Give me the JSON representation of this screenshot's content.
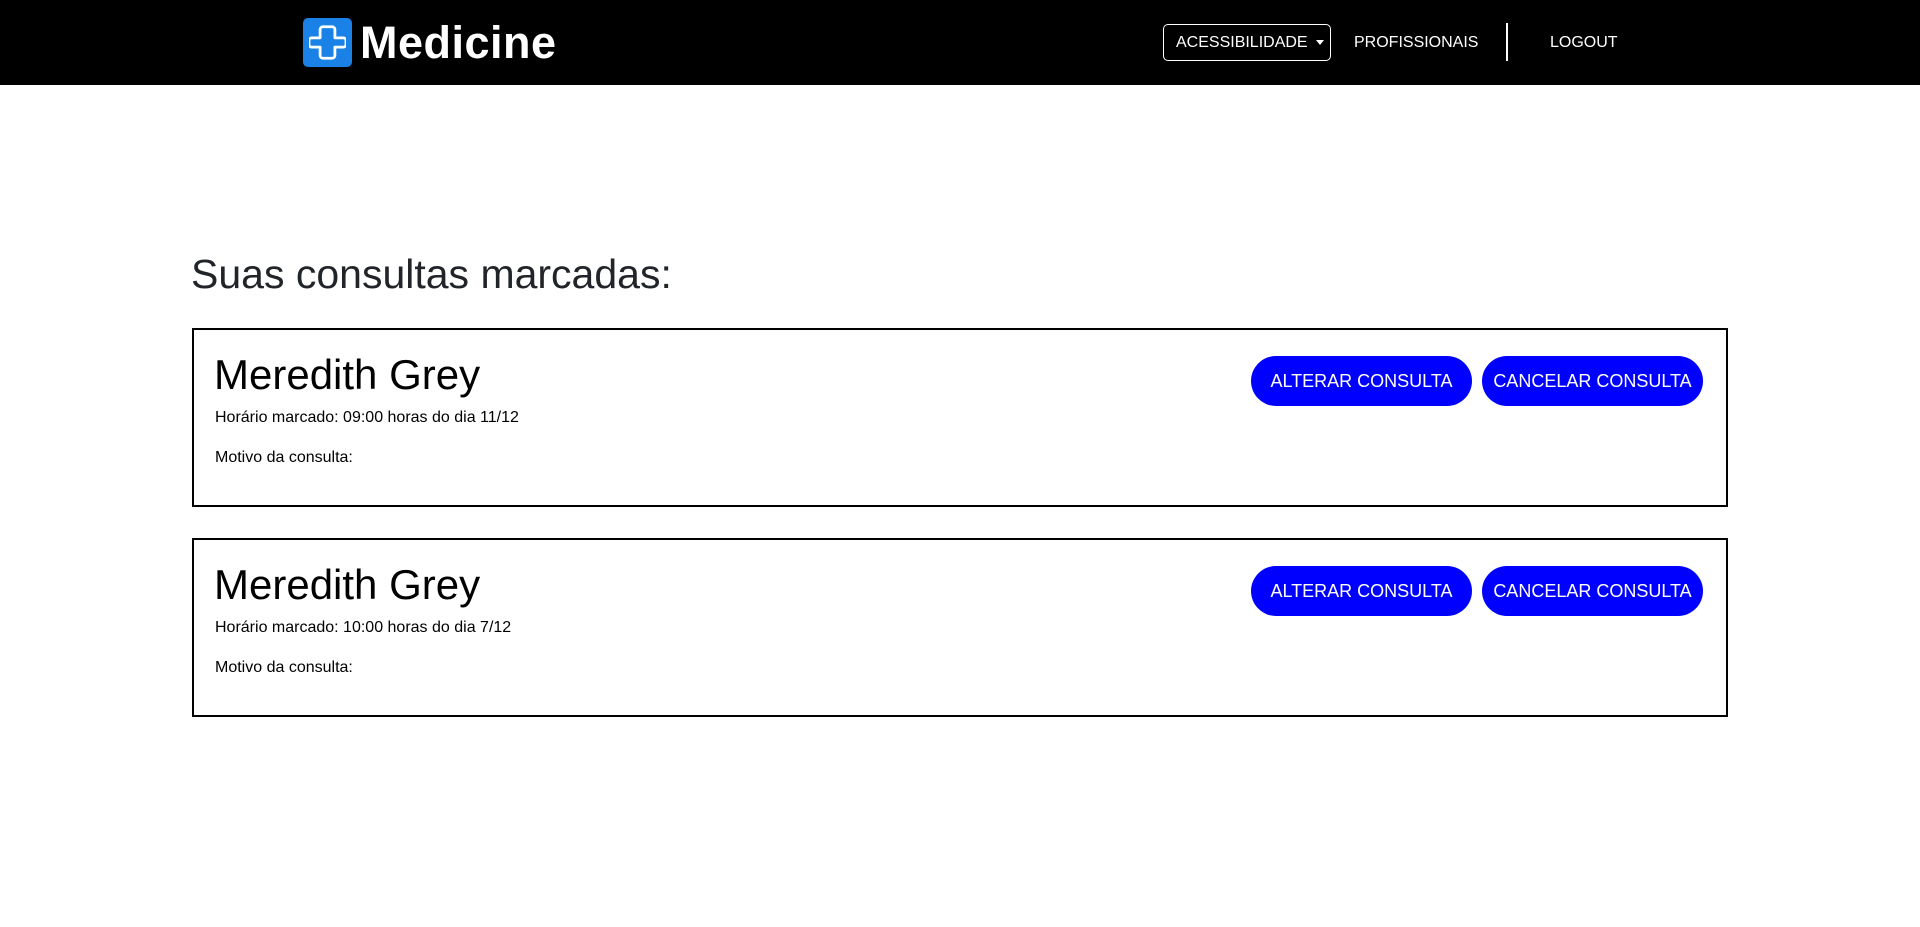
{
  "brand": {
    "name": "Medicine",
    "logo_icon": "plus-cross-icon",
    "logo_color": "#1a82e6"
  },
  "nav": {
    "accessibility_label": "ACESSIBILIDADE",
    "professionals_label": "PROFISSIONAIS",
    "logout_label": "LOGOUT"
  },
  "main": {
    "title": "Suas consultas marcadas:"
  },
  "appointments": [
    {
      "doctor": "Meredith Grey",
      "time_text": "Horário marcado: 09:00 horas do dia 11/12",
      "reason_label": "Motivo da consulta:",
      "alter_label": "ALTERAR CONSULTA",
      "cancel_label": "CANCELAR CONSULTA"
    },
    {
      "doctor": "Meredith Grey",
      "time_text": "Horário marcado: 10:00 horas do dia 7/12",
      "reason_label": "Motivo da consulta:",
      "alter_label": "ALTERAR CONSULTA",
      "cancel_label": "CANCELAR CONSULTA"
    }
  ],
  "colors": {
    "navbar_bg": "#000000",
    "button_bg": "#0000ff",
    "button_text": "#ffffff"
  }
}
